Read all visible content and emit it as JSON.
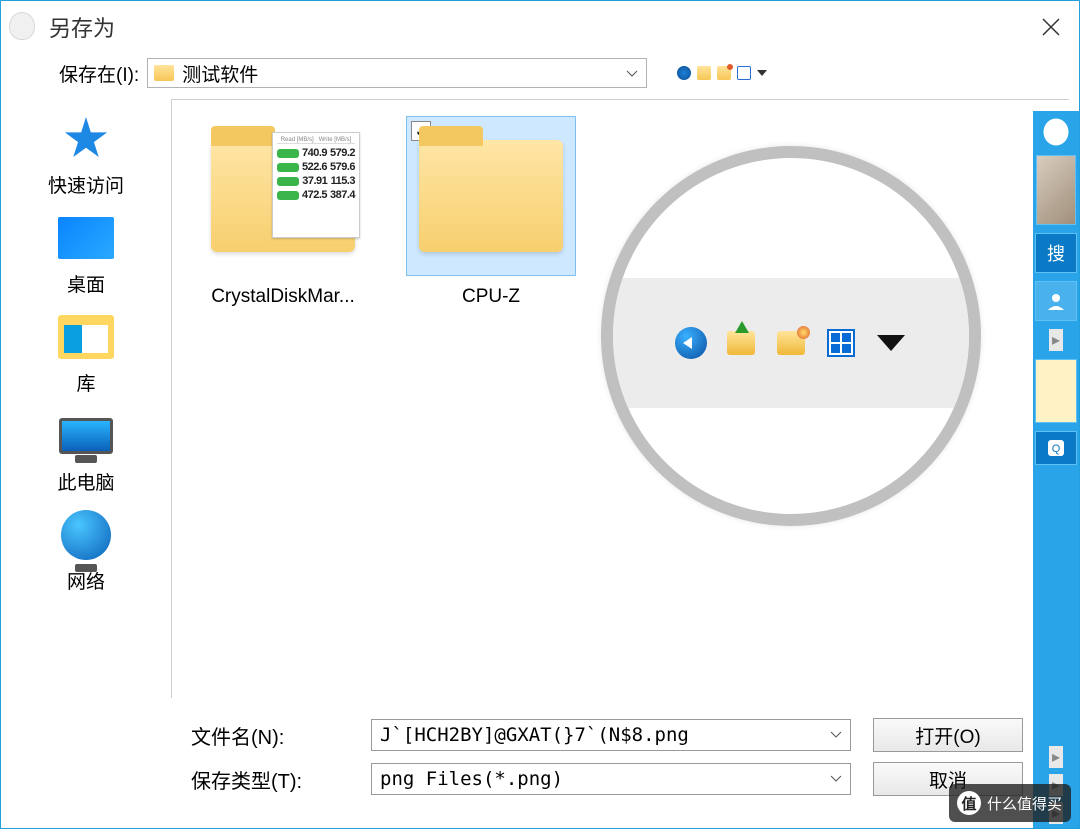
{
  "title": "另存为",
  "save_in_label": "保存在(I):",
  "save_in_value": "测试软件",
  "sidebar": {
    "items": [
      {
        "label": "快速访问"
      },
      {
        "label": "桌面"
      },
      {
        "label": "库"
      },
      {
        "label": "此电脑"
      },
      {
        "label": "网络"
      }
    ]
  },
  "files": [
    {
      "label": "CrystalDiskMar...",
      "selected": false
    },
    {
      "label": "CPU-Z",
      "selected": true
    }
  ],
  "benchmark_rows": [
    {
      "a": "740.9",
      "b": "579.2"
    },
    {
      "a": "522.6",
      "b": "579.6"
    },
    {
      "a": "37.91",
      "b": "115.3"
    },
    {
      "a": "472.5",
      "b": "387.4"
    }
  ],
  "filename_label": "文件名(N):",
  "filename_value": "J`[HCH2BY]@GXAT(}7`(N$8.png",
  "filetype_label": "保存类型(T):",
  "filetype_value": "png Files(*.png)",
  "open_button": "打开(O)",
  "cancel_button": "取消",
  "qq_search": "搜",
  "watermark": "什么值得买"
}
